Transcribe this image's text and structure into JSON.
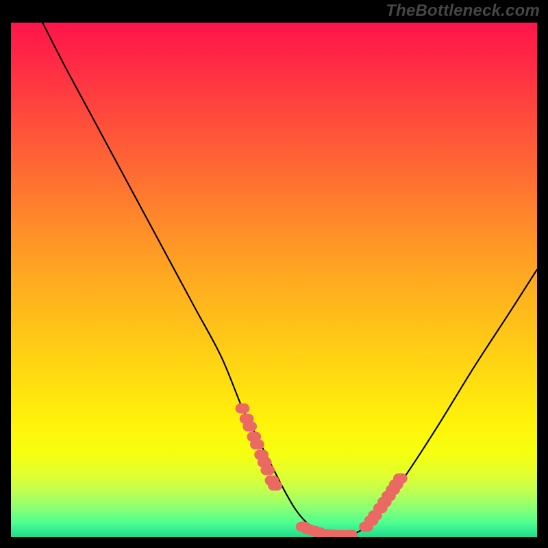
{
  "watermark": "TheBottleneck.com",
  "chart_data": {
    "type": "line",
    "title": "",
    "xlabel": "",
    "ylabel": "",
    "xlim": [
      0,
      100
    ],
    "ylim": [
      0,
      100
    ],
    "series": [
      {
        "name": "bottleneck-curve",
        "x": [
          6,
          10,
          15,
          20,
          25,
          30,
          35,
          40,
          44,
          46,
          48,
          50,
          52,
          54,
          56,
          58,
          60,
          62,
          64,
          66,
          68,
          70,
          73,
          77,
          82,
          88,
          95,
          100
        ],
        "y": [
          100,
          92,
          82.5,
          73,
          63.5,
          54,
          44.5,
          35,
          25,
          21,
          17,
          13,
          9,
          5.5,
          3,
          1.5,
          0.7,
          0.3,
          0.3,
          1,
          2.5,
          5,
          9,
          15,
          23,
          33,
          44,
          52
        ]
      }
    ],
    "markers": {
      "name": "highlight-clusters",
      "points": [
        {
          "x": 44.0,
          "y": 25.0
        },
        {
          "x": 44.8,
          "y": 23.0
        },
        {
          "x": 45.4,
          "y": 21.5
        },
        {
          "x": 46.2,
          "y": 19.5
        },
        {
          "x": 46.8,
          "y": 18.0
        },
        {
          "x": 47.6,
          "y": 16.0
        },
        {
          "x": 48.2,
          "y": 14.5
        },
        {
          "x": 48.8,
          "y": 13.0
        },
        {
          "x": 49.6,
          "y": 11.0
        },
        {
          "x": 50.2,
          "y": 10.0
        },
        {
          "x": 55.5,
          "y": 2.0
        },
        {
          "x": 56.5,
          "y": 1.5
        },
        {
          "x": 57.5,
          "y": 1.2
        },
        {
          "x": 58.5,
          "y": 0.9
        },
        {
          "x": 59.5,
          "y": 0.6
        },
        {
          "x": 60.5,
          "y": 0.5
        },
        {
          "x": 61.5,
          "y": 0.4
        },
        {
          "x": 62.5,
          "y": 0.35
        },
        {
          "x": 63.5,
          "y": 0.35
        },
        {
          "x": 64.5,
          "y": 0.4
        },
        {
          "x": 67.5,
          "y": 2.0
        },
        {
          "x": 68.5,
          "y": 3.2
        },
        {
          "x": 69.2,
          "y": 4.2
        },
        {
          "x": 70.2,
          "y": 5.6
        },
        {
          "x": 71.0,
          "y": 6.8
        },
        {
          "x": 71.8,
          "y": 8.0
        },
        {
          "x": 72.6,
          "y": 9.2
        },
        {
          "x": 73.2,
          "y": 10.2
        },
        {
          "x": 74.0,
          "y": 11.4
        }
      ]
    },
    "gradient_stops": [
      {
        "offset": 0.0,
        "color": "#ff154a"
      },
      {
        "offset": 0.08,
        "color": "#ff2b45"
      },
      {
        "offset": 0.18,
        "color": "#ff4b3c"
      },
      {
        "offset": 0.28,
        "color": "#ff6a33"
      },
      {
        "offset": 0.38,
        "color": "#ff8a2a"
      },
      {
        "offset": 0.48,
        "color": "#ffa821"
      },
      {
        "offset": 0.58,
        "color": "#ffc318"
      },
      {
        "offset": 0.68,
        "color": "#ffdd10"
      },
      {
        "offset": 0.76,
        "color": "#fff30a"
      },
      {
        "offset": 0.82,
        "color": "#f6ff10"
      },
      {
        "offset": 0.86,
        "color": "#e0ff30"
      },
      {
        "offset": 0.89,
        "color": "#c0ff50"
      },
      {
        "offset": 0.92,
        "color": "#90ff70"
      },
      {
        "offset": 0.95,
        "color": "#50ff90"
      },
      {
        "offset": 0.975,
        "color": "#20e090"
      },
      {
        "offset": 1.0,
        "color": "#08c080"
      }
    ]
  }
}
